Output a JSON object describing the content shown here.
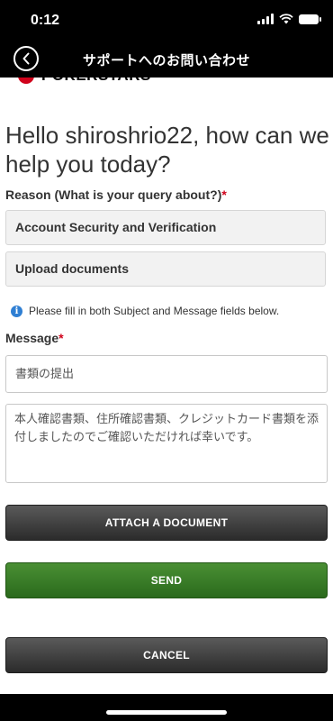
{
  "status_bar": {
    "time": "0:12"
  },
  "nav": {
    "title": "サポートへのお問い合わせ"
  },
  "logo": {
    "text": "POKERSTARS"
  },
  "form": {
    "greeting": "Hello shiroshrio22, how can we help you today?",
    "reason_label": "Reason (What is your query about?)",
    "required_mark": "*",
    "reason_select": "Account Security and Verification",
    "subreason_select": "Upload documents",
    "info_text": "Please fill in both Subject and Message fields below.",
    "message_label": "Message",
    "subject_value": "書類の提出",
    "message_value": "本人確認書類、住所確認書類、クレジットカード書類を添付しましたのでご確認いただければ幸いです。"
  },
  "buttons": {
    "attach": "ATTACH A DOCUMENT",
    "send": "SEND",
    "cancel": "CANCEL"
  },
  "colors": {
    "accent_red": "#d0021b",
    "send_green": "#2a6a1c",
    "info_blue": "#2f7fd3"
  }
}
